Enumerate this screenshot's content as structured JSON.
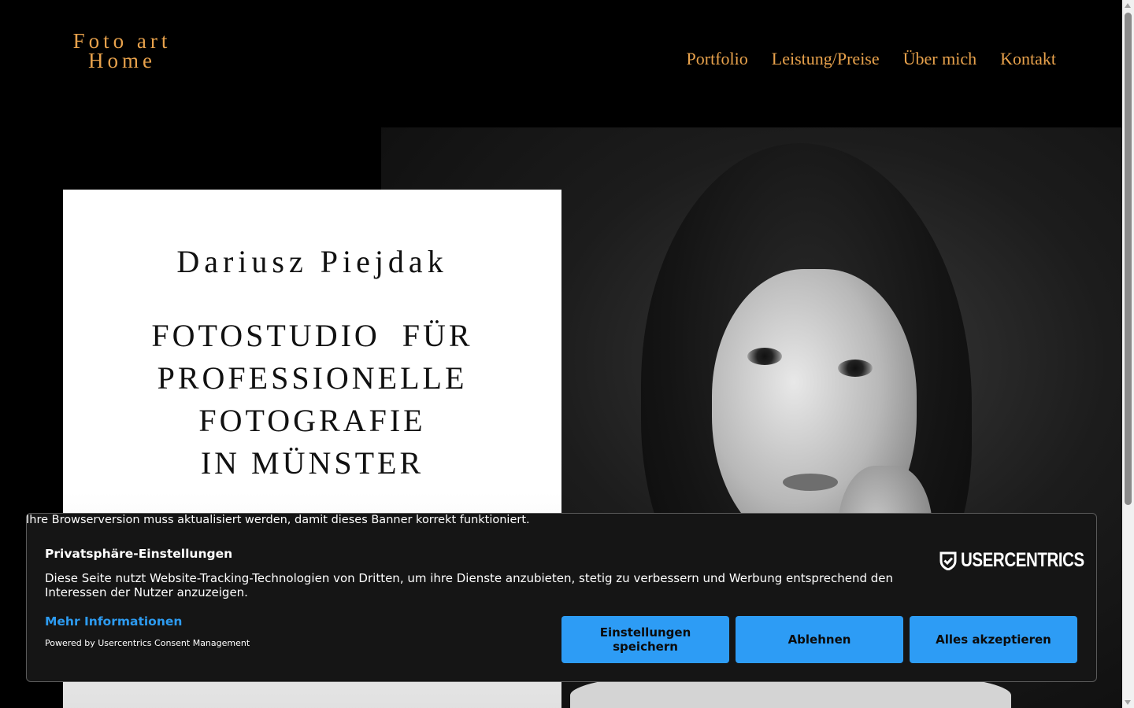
{
  "header": {
    "logo_line1": "Foto art",
    "logo_line2": "Home",
    "nav": [
      "Portfolio",
      "Leistung/Preise",
      "Über mich",
      "Kontakt"
    ]
  },
  "hero": {
    "name": "Dariusz Piejdak",
    "headline_lines": [
      "FOTOSTUDIO  FÜR",
      "PROFESSIONELLE",
      "FOTOGRAFIE",
      "IN MÜNSTER"
    ]
  },
  "consent": {
    "browser_warning": "Ihre Browserversion muss aktualisiert werden, damit dieses Banner korrekt funktioniert.",
    "title": "Privatsphäre-Einstellungen",
    "description": "Diese Seite nutzt Website-Tracking-Technologien von Dritten, um ihre Dienste anzubieten, stetig zu verbessern und Werbung entsprechend den Interessen der Nutzer anzuzeigen.",
    "more_info": "Mehr Informationen",
    "powered_by": "Powered by Usercentrics Consent Management",
    "brand": "USERCENTRICS",
    "buttons": {
      "settings": "Einstellungen speichern",
      "deny": "Ablehnen",
      "accept": "Alles akzeptieren"
    }
  },
  "colors": {
    "accent": "#e8a24c",
    "background": "#000000",
    "consent_bg": "#151515",
    "button_blue": "#2d9cf5",
    "link_blue": "#2d9bf0"
  }
}
